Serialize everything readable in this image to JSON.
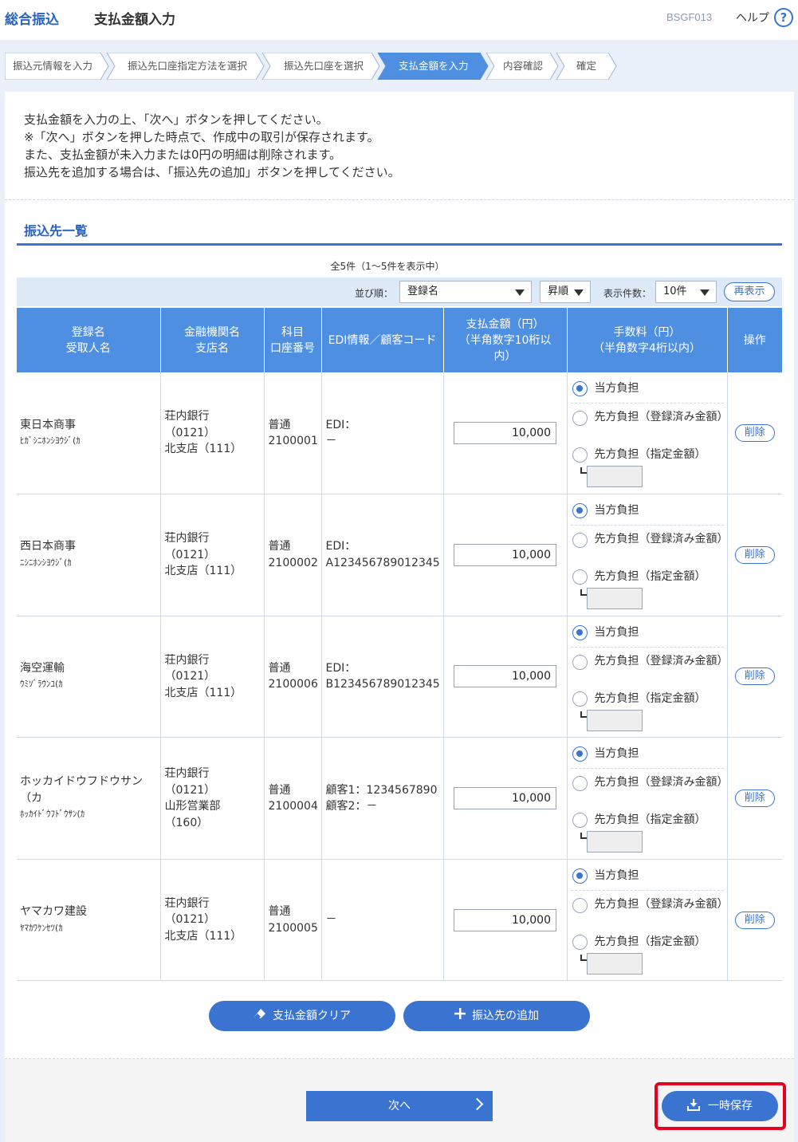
{
  "header": {
    "app_name": "総合振込",
    "page_title": "支払金額入力",
    "screen_id": "BSGF013",
    "help_label": "ヘルプ",
    "help_icon": "?"
  },
  "steps": [
    {
      "label": "振込元情報を入力",
      "active": false
    },
    {
      "label": "振込先口座指定方法を選択",
      "active": false
    },
    {
      "label": "振込先口座を選択",
      "active": false
    },
    {
      "label": "支払金額を入力",
      "active": true
    },
    {
      "label": "内容確認",
      "active": false
    },
    {
      "label": "確定",
      "active": false
    }
  ],
  "intro": {
    "line1": "支払金額を入力の上、「次へ」ボタンを押してください。",
    "line2": "※「次へ」ボタンを押した時点で、作成中の取引が保存されます。",
    "line3": "また、支払金額が未入力または0円の明細は削除されます。",
    "line4": "振込先を追加する場合は、「振込先の追加」ボタンを押してください。"
  },
  "list": {
    "title": "振込先一覧",
    "count_text": "全5件（1～5件を表示中）",
    "sort_label": "並び順：",
    "sort_value": "登録名",
    "order_value": "昇順",
    "per_page_label": "表示件数：",
    "per_page_value": "10件",
    "redisplay_label": "再表示"
  },
  "columns": {
    "name_1": "登録名",
    "name_2": "受取人名",
    "bank_1": "金融機関名",
    "bank_2": "支店名",
    "acct_1": "科目",
    "acct_2": "口座番号",
    "edi": "EDI情報／顧客コード",
    "amount_1": "支払金額（円）",
    "amount_2": "（半角数字10桁以",
    "amount_3": "内）",
    "fee_1": "手数料（円）",
    "fee_2": "（半角数字4桁以内）",
    "op": "操作"
  },
  "fee_options": {
    "own": "当方負担",
    "registered": "先方負担（登録済み金額）",
    "specified": "先方負担（指定金額）"
  },
  "delete_label": "削除",
  "rows": [
    {
      "name": "東日本商事",
      "kana": "ﾋｶﾞｼﾆﾎﾝｼﾖｳｼﾞ(ｶ",
      "bank": "荘内銀行",
      "bank_code": "（0121）",
      "branch": "北支店（111）",
      "branch2": "",
      "type": "普通",
      "number": "2100001",
      "edi1": "EDI：",
      "edi2": "－",
      "amount": "10,000"
    },
    {
      "name": "西日本商事",
      "kana": "ﾆｼﾆﾎﾝｼﾖｳｼﾞ(ｶ",
      "bank": "荘内銀行",
      "bank_code": "（0121）",
      "branch": "北支店（111）",
      "branch2": "",
      "type": "普通",
      "number": "2100002",
      "edi1": "EDI：",
      "edi2": "A123456789012345",
      "amount": "10,000"
    },
    {
      "name": "海空運輸",
      "kana": "ｳﾐｿﾞﾗｳﾝﾕ(ｶ",
      "bank": "荘内銀行",
      "bank_code": "（0121）",
      "branch": "北支店（111）",
      "branch2": "",
      "type": "普通",
      "number": "2100006",
      "edi1": "EDI：",
      "edi2": "B123456789012345",
      "amount": "10,000"
    },
    {
      "name": "ホッカイドウフドウサン（カ",
      "kana": "ﾎｯｶｲﾄﾞｳﾌﾄﾞｳｻﾝ(ｶ",
      "bank": "荘内銀行",
      "bank_code": "（0121）",
      "branch": "山形営業部",
      "branch2": "（160）",
      "type": "普通",
      "number": "2100004",
      "edi1": "顧客1：1234567890",
      "edi2": "顧客2：－",
      "amount": "10,000"
    },
    {
      "name": "ヤマカワ建設",
      "kana": "ﾔﾏｶﾜｹﾝｾﾂ(ｶ",
      "bank": "荘内銀行",
      "bank_code": "（0121）",
      "branch": "北支店（111）",
      "branch2": "",
      "type": "普通",
      "number": "2100005",
      "edi1": "－",
      "edi2": "",
      "amount": "10,000"
    }
  ],
  "actions": {
    "clear_label": "支払金額クリア",
    "add_label": "振込先の追加",
    "next_label": "次へ",
    "save_label": "一時保存"
  }
}
